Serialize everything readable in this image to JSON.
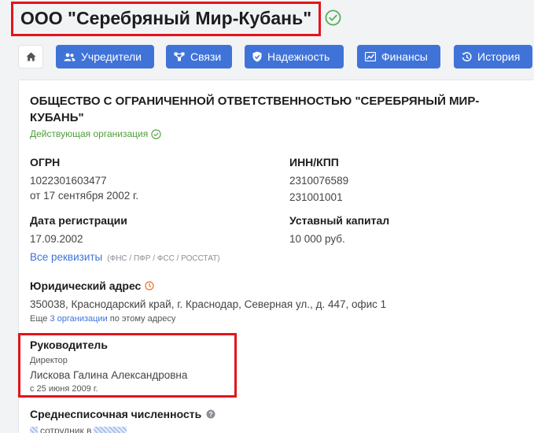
{
  "header": {
    "company_short_name": "ООО \"Серебряный Мир-Кубань\""
  },
  "nav": {
    "founders": "Учредители",
    "connections": "Связи",
    "reliability": "Надежность",
    "finances": "Финансы",
    "history": "История"
  },
  "company": {
    "full_name": "ОБЩЕСТВО С ОГРАНИЧЕННОЙ ОТВЕТСТВЕННОСТЬЮ \"СЕРЕБРЯНЫЙ МИР-КУБАНЬ\"",
    "status": "Действующая организация",
    "ogrn_label": "ОГРН",
    "ogrn": "1022301603477",
    "ogrn_date": "от 17 сентября 2002 г.",
    "inn_kpp_label": "ИНН/КПП",
    "inn": "2310076589",
    "kpp": "231001001",
    "reg_date_label": "Дата регистрации",
    "reg_date": "17.09.2002",
    "capital_label": "Уставный капитал",
    "capital": "10 000 руб.",
    "all_details_link": "Все реквизиты",
    "all_details_sources": "(ФНС / ПФР / ФСС / РОССТАТ)",
    "address_label": "Юридический адрес",
    "address": "350038, Краснодарский край, г. Краснодар, Северная ул., д. 447, офис 1",
    "address_more_prefix": "Еще",
    "address_more_link": "3 организации",
    "address_more_suffix": "по этому адресу",
    "leader_label": "Руководитель",
    "leader_position": "Директор",
    "leader_name": "Лискова Галина Александровна",
    "leader_since": "с 25 июня 2009 г.",
    "employees_label": "Среднесписочная численность",
    "employees_unit": "сотрудник в"
  }
}
